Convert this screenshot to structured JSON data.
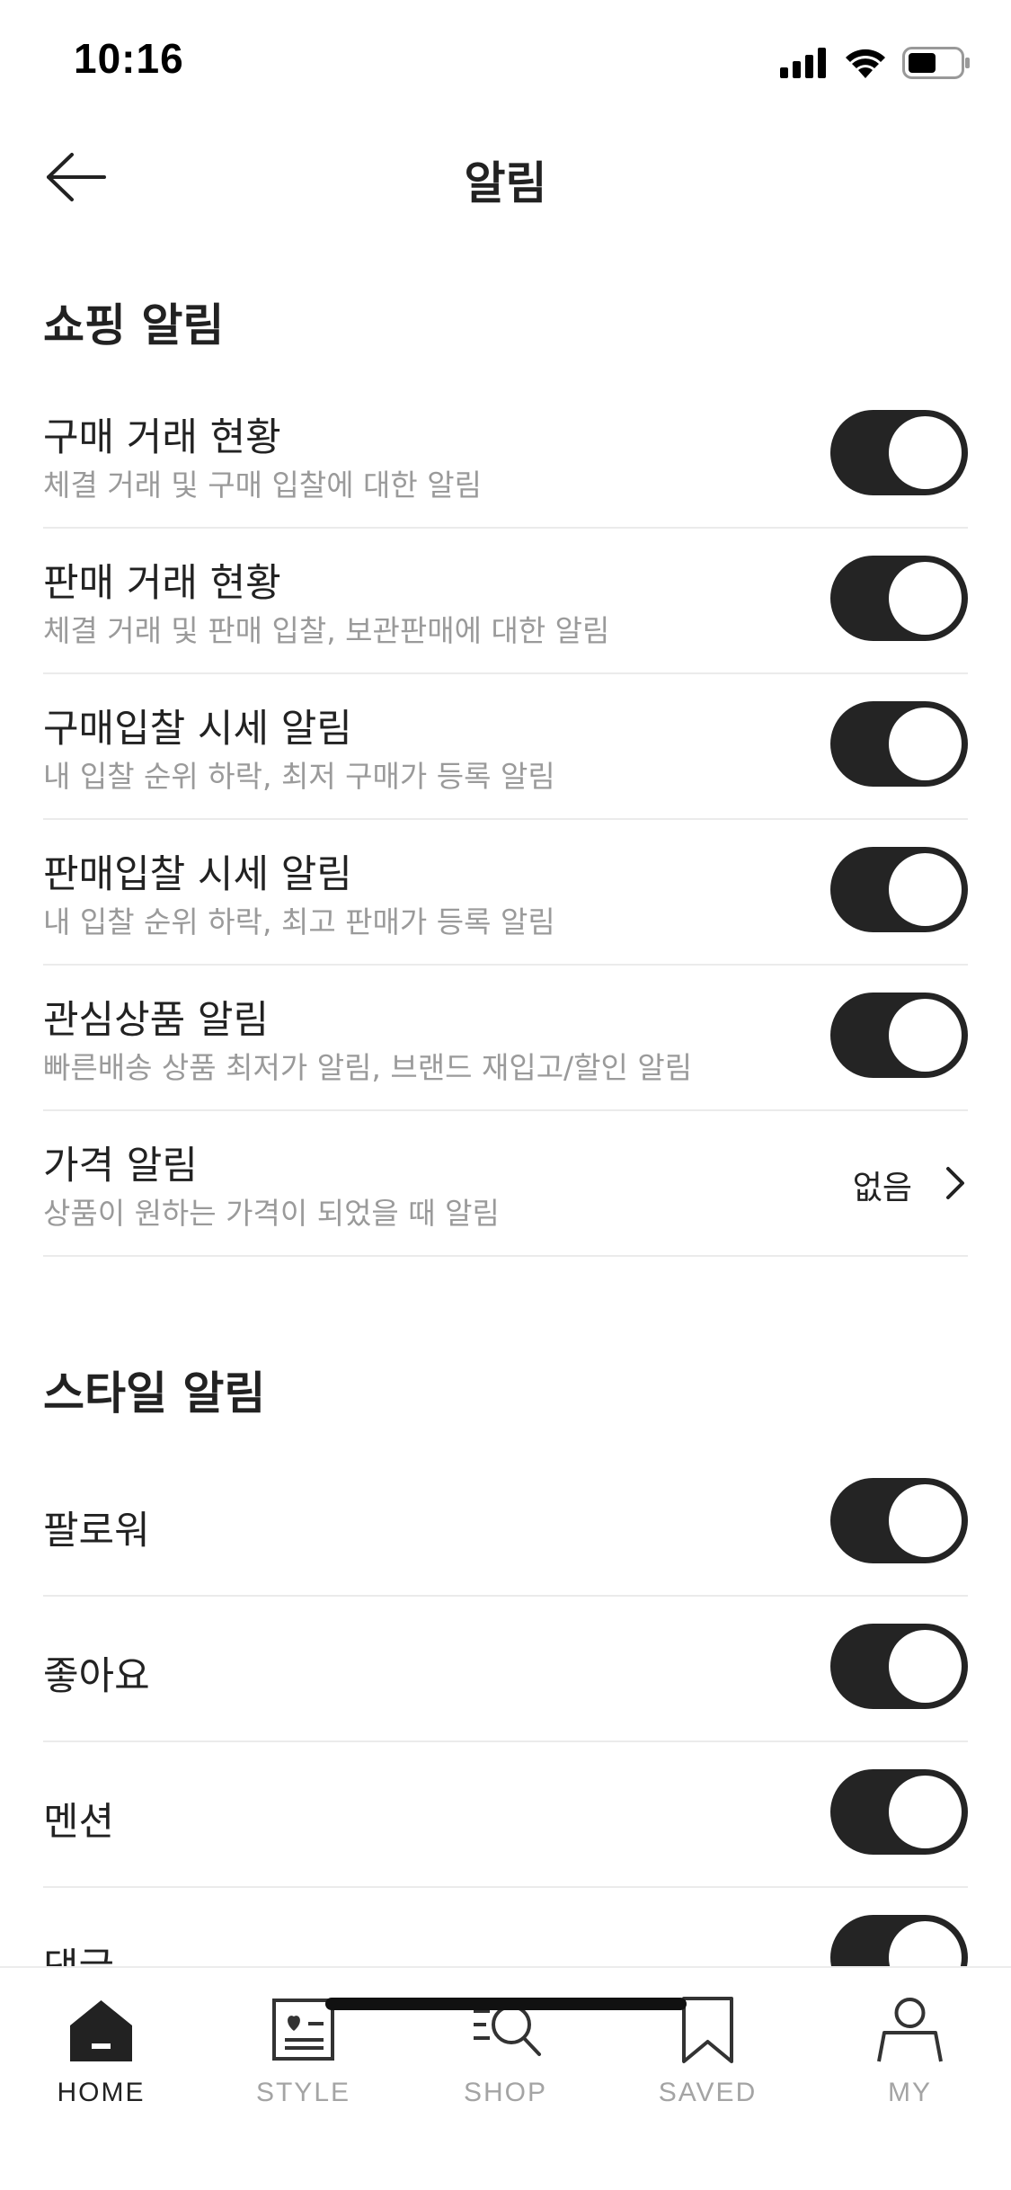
{
  "status_bar": {
    "time": "10:16"
  },
  "header": {
    "title": "알림"
  },
  "shopping": {
    "section_title": "쇼핑 알림",
    "items": [
      {
        "title": "구매 거래 현황",
        "desc": "체결 거래 및 구매 입찰에 대한 알림",
        "on": true
      },
      {
        "title": "판매 거래 현황",
        "desc": "체결 거래 및 판매 입찰, 보관판매에 대한 알림",
        "on": true
      },
      {
        "title": "구매입찰 시세 알림",
        "desc": "내 입찰 순위 하락, 최저 구매가 등록 알림",
        "on": true
      },
      {
        "title": "판매입찰 시세 알림",
        "desc": "내 입찰 순위 하락, 최고 판매가 등록 알림",
        "on": true
      },
      {
        "title": "관심상품 알림",
        "desc": "빠른배송 상품 최저가 알림, 브랜드 재입고/할인 알림",
        "on": true
      },
      {
        "title": "가격 알림",
        "desc": "상품이 원하는 가격이 되었을 때 알림",
        "value": "없음"
      }
    ]
  },
  "style": {
    "section_title": "스타일 알림",
    "items": [
      {
        "title": "팔로워",
        "on": true
      },
      {
        "title": "좋아요",
        "on": true
      },
      {
        "title": "멘션",
        "on": true
      },
      {
        "title": "댓글",
        "on": true
      }
    ]
  },
  "tab_bar": {
    "tabs": [
      {
        "label": "HOME",
        "icon": "home-icon",
        "active": true
      },
      {
        "label": "STYLE",
        "icon": "style-icon",
        "active": false
      },
      {
        "label": "SHOP",
        "icon": "shop-search-icon",
        "active": false
      },
      {
        "label": "SAVED",
        "icon": "bookmark-icon",
        "active": false
      },
      {
        "label": "MY",
        "icon": "person-icon",
        "active": false
      }
    ]
  },
  "colors": {
    "toggle_on": "#242424",
    "divider": "#ebebeb",
    "muted_text": "#9a9a9a",
    "inactive_tab": "#a4a4a4"
  }
}
